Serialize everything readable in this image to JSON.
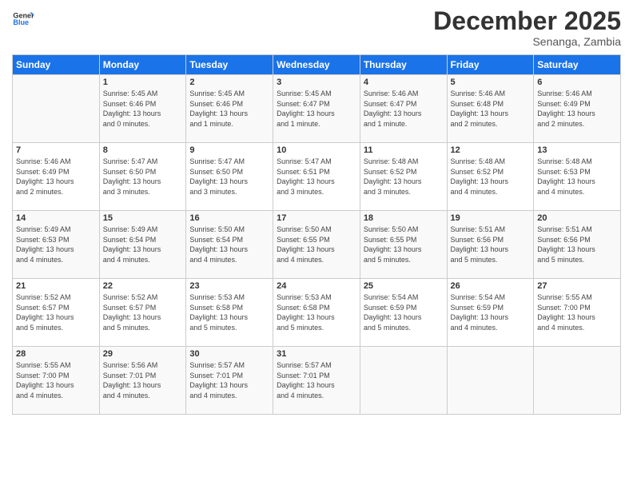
{
  "header": {
    "logo_line1": "General",
    "logo_line2": "Blue",
    "month": "December 2025",
    "location": "Senanga, Zambia"
  },
  "columns": [
    "Sunday",
    "Monday",
    "Tuesday",
    "Wednesday",
    "Thursday",
    "Friday",
    "Saturday"
  ],
  "weeks": [
    [
      {
        "day": "",
        "info": ""
      },
      {
        "day": "1",
        "info": "Sunrise: 5:45 AM\nSunset: 6:46 PM\nDaylight: 13 hours\nand 0 minutes."
      },
      {
        "day": "2",
        "info": "Sunrise: 5:45 AM\nSunset: 6:46 PM\nDaylight: 13 hours\nand 1 minute."
      },
      {
        "day": "3",
        "info": "Sunrise: 5:45 AM\nSunset: 6:47 PM\nDaylight: 13 hours\nand 1 minute."
      },
      {
        "day": "4",
        "info": "Sunrise: 5:46 AM\nSunset: 6:47 PM\nDaylight: 13 hours\nand 1 minute."
      },
      {
        "day": "5",
        "info": "Sunrise: 5:46 AM\nSunset: 6:48 PM\nDaylight: 13 hours\nand 2 minutes."
      },
      {
        "day": "6",
        "info": "Sunrise: 5:46 AM\nSunset: 6:49 PM\nDaylight: 13 hours\nand 2 minutes."
      }
    ],
    [
      {
        "day": "7",
        "info": "Sunrise: 5:46 AM\nSunset: 6:49 PM\nDaylight: 13 hours\nand 2 minutes."
      },
      {
        "day": "8",
        "info": "Sunrise: 5:47 AM\nSunset: 6:50 PM\nDaylight: 13 hours\nand 3 minutes."
      },
      {
        "day": "9",
        "info": "Sunrise: 5:47 AM\nSunset: 6:50 PM\nDaylight: 13 hours\nand 3 minutes."
      },
      {
        "day": "10",
        "info": "Sunrise: 5:47 AM\nSunset: 6:51 PM\nDaylight: 13 hours\nand 3 minutes."
      },
      {
        "day": "11",
        "info": "Sunrise: 5:48 AM\nSunset: 6:52 PM\nDaylight: 13 hours\nand 3 minutes."
      },
      {
        "day": "12",
        "info": "Sunrise: 5:48 AM\nSunset: 6:52 PM\nDaylight: 13 hours\nand 4 minutes."
      },
      {
        "day": "13",
        "info": "Sunrise: 5:48 AM\nSunset: 6:53 PM\nDaylight: 13 hours\nand 4 minutes."
      }
    ],
    [
      {
        "day": "14",
        "info": "Sunrise: 5:49 AM\nSunset: 6:53 PM\nDaylight: 13 hours\nand 4 minutes."
      },
      {
        "day": "15",
        "info": "Sunrise: 5:49 AM\nSunset: 6:54 PM\nDaylight: 13 hours\nand 4 minutes."
      },
      {
        "day": "16",
        "info": "Sunrise: 5:50 AM\nSunset: 6:54 PM\nDaylight: 13 hours\nand 4 minutes."
      },
      {
        "day": "17",
        "info": "Sunrise: 5:50 AM\nSunset: 6:55 PM\nDaylight: 13 hours\nand 4 minutes."
      },
      {
        "day": "18",
        "info": "Sunrise: 5:50 AM\nSunset: 6:55 PM\nDaylight: 13 hours\nand 5 minutes."
      },
      {
        "day": "19",
        "info": "Sunrise: 5:51 AM\nSunset: 6:56 PM\nDaylight: 13 hours\nand 5 minutes."
      },
      {
        "day": "20",
        "info": "Sunrise: 5:51 AM\nSunset: 6:56 PM\nDaylight: 13 hours\nand 5 minutes."
      }
    ],
    [
      {
        "day": "21",
        "info": "Sunrise: 5:52 AM\nSunset: 6:57 PM\nDaylight: 13 hours\nand 5 minutes."
      },
      {
        "day": "22",
        "info": "Sunrise: 5:52 AM\nSunset: 6:57 PM\nDaylight: 13 hours\nand 5 minutes."
      },
      {
        "day": "23",
        "info": "Sunrise: 5:53 AM\nSunset: 6:58 PM\nDaylight: 13 hours\nand 5 minutes."
      },
      {
        "day": "24",
        "info": "Sunrise: 5:53 AM\nSunset: 6:58 PM\nDaylight: 13 hours\nand 5 minutes."
      },
      {
        "day": "25",
        "info": "Sunrise: 5:54 AM\nSunset: 6:59 PM\nDaylight: 13 hours\nand 5 minutes."
      },
      {
        "day": "26",
        "info": "Sunrise: 5:54 AM\nSunset: 6:59 PM\nDaylight: 13 hours\nand 4 minutes."
      },
      {
        "day": "27",
        "info": "Sunrise: 5:55 AM\nSunset: 7:00 PM\nDaylight: 13 hours\nand 4 minutes."
      }
    ],
    [
      {
        "day": "28",
        "info": "Sunrise: 5:55 AM\nSunset: 7:00 PM\nDaylight: 13 hours\nand 4 minutes."
      },
      {
        "day": "29",
        "info": "Sunrise: 5:56 AM\nSunset: 7:01 PM\nDaylight: 13 hours\nand 4 minutes."
      },
      {
        "day": "30",
        "info": "Sunrise: 5:57 AM\nSunset: 7:01 PM\nDaylight: 13 hours\nand 4 minutes."
      },
      {
        "day": "31",
        "info": "Sunrise: 5:57 AM\nSunset: 7:01 PM\nDaylight: 13 hours\nand 4 minutes."
      },
      {
        "day": "",
        "info": ""
      },
      {
        "day": "",
        "info": ""
      },
      {
        "day": "",
        "info": ""
      }
    ]
  ]
}
